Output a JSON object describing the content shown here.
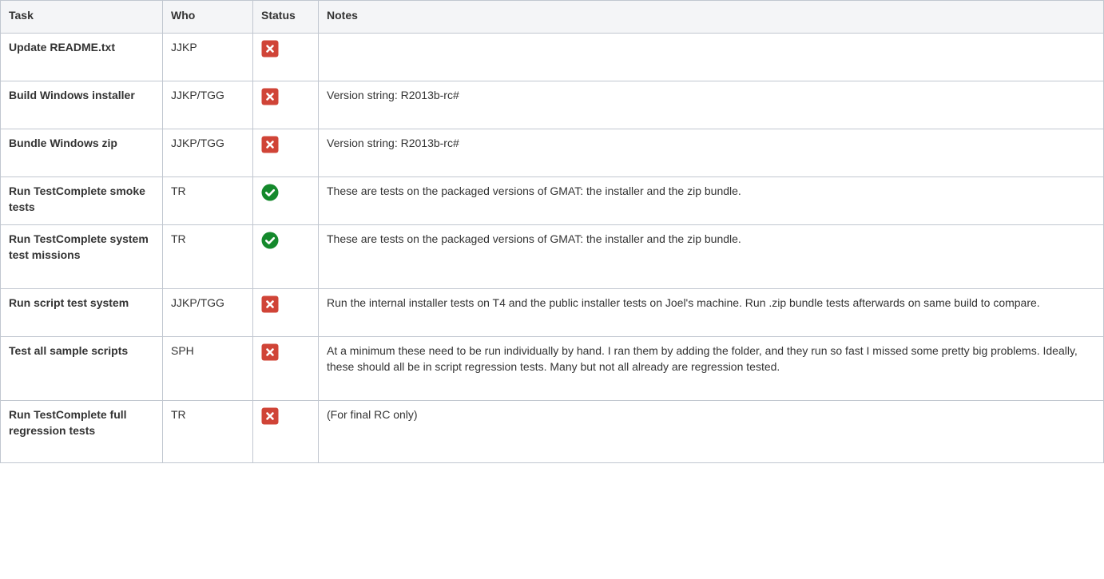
{
  "headers": {
    "task": "Task",
    "who": "Who",
    "status": "Status",
    "notes": "Notes"
  },
  "colors": {
    "fail": "#d04437",
    "pass": "#14892c",
    "header_bg": "#f4f5f7",
    "border": "#c1c7d0"
  },
  "rows": [
    {
      "task": "Update README.txt",
      "who": "JJKP",
      "status": "fail",
      "status_icon": "cross-icon",
      "notes": ""
    },
    {
      "task": "Build Windows installer",
      "who": "JJKP/TGG",
      "status": "fail",
      "status_icon": "cross-icon",
      "notes": "Version string: R2013b-rc#"
    },
    {
      "task": "Bundle Windows zip",
      "who": "JJKP/TGG",
      "status": "fail",
      "status_icon": "cross-icon",
      "notes": "Version string: R2013b-rc#"
    },
    {
      "task": "Run TestComplete smoke tests",
      "who": "TR",
      "status": "pass",
      "status_icon": "check-icon",
      "notes": "These are tests on the packaged versions of GMAT: the installer and the zip bundle."
    },
    {
      "task": "Run TestComplete system test missions",
      "who": "TR",
      "status": "pass",
      "status_icon": "check-icon",
      "notes": "These are tests on the packaged versions of GMAT: the installer and the zip bundle."
    },
    {
      "task": "Run script test system",
      "who": "JJKP/TGG",
      "status": "fail",
      "status_icon": "cross-icon",
      "notes": "Run the internal installer tests on T4 and the public installer tests on Joel's machine. Run .zip bundle tests afterwards on same build to compare."
    },
    {
      "task": "Test all sample scripts",
      "who": "SPH",
      "status": "fail",
      "status_icon": "cross-icon",
      "notes": "At a minimum these need to be run individually by hand.  I ran them by adding the folder, and they run so fast I missed some pretty big problems.  Ideally, these should all be in script regression tests.  Many but not all already are regression tested."
    },
    {
      "task": "Run TestComplete full regression tests",
      "who": "TR",
      "status": "fail",
      "status_icon": "cross-icon",
      "notes": "(For final RC only)"
    }
  ]
}
